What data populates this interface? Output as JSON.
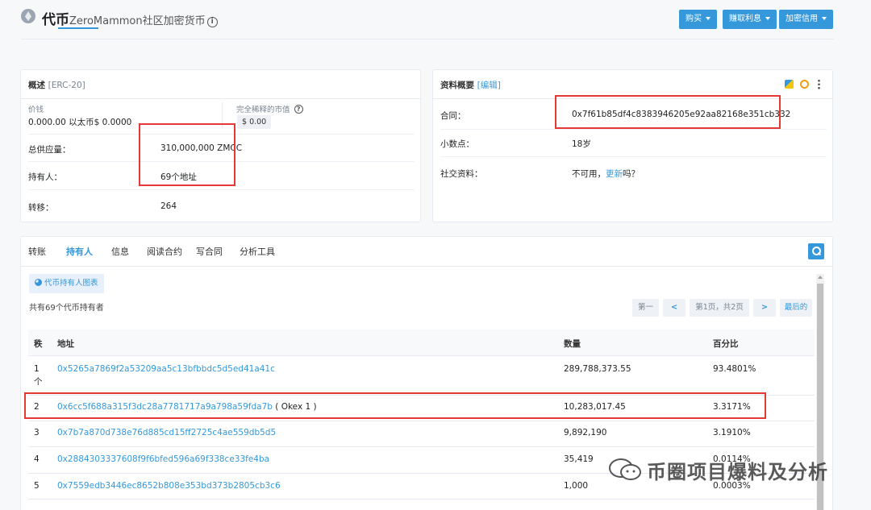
{
  "header": {
    "title": "代币",
    "token_name": "ZeroMammon社区加密货币",
    "buttons": [
      "购买",
      "赚取利息",
      "加密信用"
    ]
  },
  "overview": {
    "title": "概述",
    "tag": "[ERC-20]",
    "price_label": "价钱",
    "price_value": "0.000.00 以太币$ 0.0000",
    "market_cap_label": "完全稀释的市值",
    "market_cap_value": "$ 0.00",
    "rows": [
      {
        "label": "总供应量：",
        "value": "310,000,000 ZMCC"
      },
      {
        "label": "持有人：",
        "value": "69个地址"
      },
      {
        "label": "转移：",
        "value": "264"
      }
    ]
  },
  "profile": {
    "title": "资料概要",
    "edit": "[编辑]",
    "contract_label": "合同：",
    "contract_value": "0x7f61b85df4c8383946205e92aa82168e351cb332",
    "decimals_label": "小数点：",
    "decimals_value": "18岁",
    "social_label": "社交资料：",
    "social_prefix": "不可用，",
    "social_link": "更新",
    "social_suffix": "吗？"
  },
  "tabs": [
    "转账",
    "持有人",
    "信息",
    "阅读合约",
    "写合同",
    "分析工具"
  ],
  "holders": {
    "chart_button": "代币持有人图表",
    "summary": "共有69个代币持有者",
    "pagination": {
      "first": "第一",
      "prev": "<",
      "page": "第1页，共2页",
      "next": ">",
      "last": "最后的"
    },
    "columns": [
      "秩",
      "地址",
      "数量",
      "百分比"
    ],
    "rows": [
      {
        "rank": "1",
        "rank_suffix": "个",
        "address": "0x5265a7869f2a53209aa5c13bfbbdc5d5ed41a41c",
        "note": "",
        "quantity": "289,788,373.55",
        "percent": "93.4801%"
      },
      {
        "rank": "2",
        "rank_suffix": "",
        "address": "0x6cc5f688a315f3dc28a7781717a9a798a59fda7b",
        "note": "( Okex 1 )",
        "quantity": "10,283,017.45",
        "percent": "3.3171%"
      },
      {
        "rank": "3",
        "rank_suffix": "",
        "address": "0x7b7a870d738e76d885cd15ff2725c4ae559db5d5",
        "note": "",
        "quantity": "9,892,190",
        "percent": "3.1910%"
      },
      {
        "rank": "4",
        "rank_suffix": "",
        "address": "0x2884303337608f9f6bfed596a69f338ce33fe4ba",
        "note": "",
        "quantity": "35,419",
        "percent": "0.0114%"
      },
      {
        "rank": "5",
        "rank_suffix": "",
        "address": "0x7559edb3446ec8652b808e353bd373b2805cb3c6",
        "note": "",
        "quantity": "1,000",
        "percent": "0.0003%"
      }
    ]
  },
  "watermark": "币圈项目爆料及分析",
  "colors": {
    "accent": "#3498db",
    "highlight": "#e53935"
  }
}
